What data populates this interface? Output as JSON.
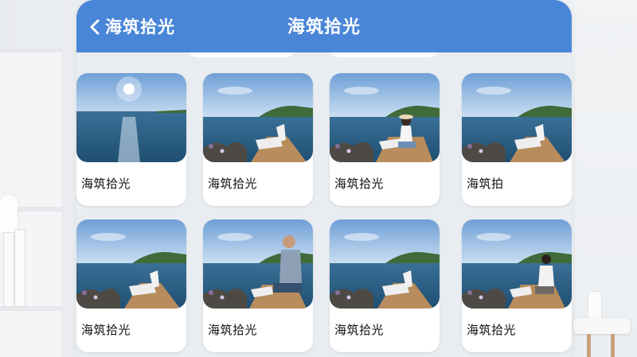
{
  "header": {
    "back_label": "海筑拾光",
    "title": "海筑拾光"
  },
  "cards": [
    {
      "label": "海筑拾光",
      "scene": "sun-sea"
    },
    {
      "label": "海筑拾光",
      "scene": "deck-chair"
    },
    {
      "label": "海筑拾光",
      "scene": "woman-hat"
    },
    {
      "label": "海筑拍",
      "scene": "deck-chair"
    },
    {
      "label": "海筑拾光",
      "scene": "deck-chair"
    },
    {
      "label": "海筑拾光",
      "scene": "man-seated"
    },
    {
      "label": "海筑拾光",
      "scene": "deck-chair"
    },
    {
      "label": "海筑拾光",
      "scene": "woman-seated"
    }
  ],
  "colors": {
    "header": "#4a86d8",
    "card": "#ffffff"
  }
}
